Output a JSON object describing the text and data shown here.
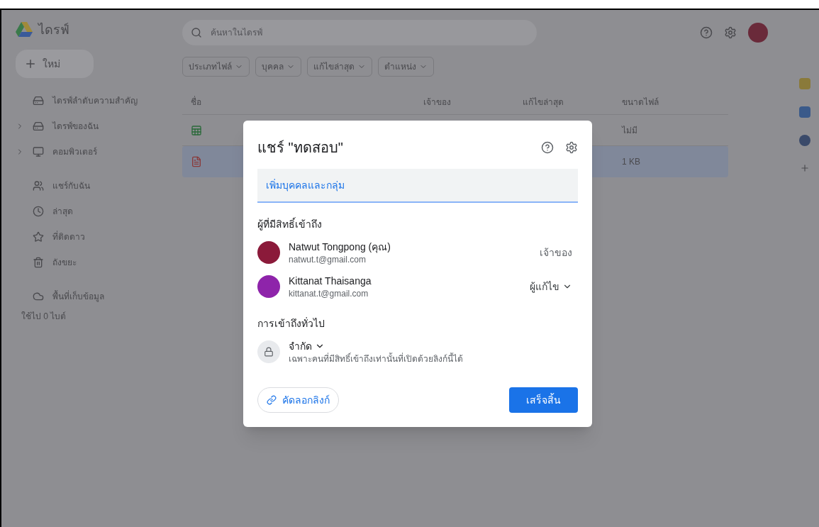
{
  "app": {
    "name": "ไดรฟ์"
  },
  "search": {
    "placeholder": "ค้นหาในไดรฟ์"
  },
  "new_button": "ใหม่",
  "sidebar": {
    "items": [
      {
        "label": "ไดรฟ์ลำดับความสำคัญ",
        "expandable": false
      },
      {
        "label": "ไดรฟ์ของฉัน",
        "expandable": true
      },
      {
        "label": "คอมพิวเตอร์",
        "expandable": true
      },
      {
        "label": "แชร์กับฉัน",
        "expandable": false
      },
      {
        "label": "ล่าสุด",
        "expandable": false
      },
      {
        "label": "ที่ติดดาว",
        "expandable": false
      },
      {
        "label": "ถังขยะ",
        "expandable": false
      }
    ],
    "storage": {
      "label": "พื้นที่เก็บข้อมูล",
      "usage": "ใช้ไป 0 ไบต์"
    }
  },
  "filters": [
    "ประเภทไฟล์",
    "บุคคล",
    "แก้ไขล่าสุด",
    "ตำแหน่ง"
  ],
  "table": {
    "columns": [
      "ชื่อ",
      "เจ้าของ",
      "แก้ไขล่าสุด",
      "ขนาดไฟล์"
    ],
    "rows": [
      {
        "kind": "sheet",
        "size": "ไม่มี",
        "selected": false
      },
      {
        "kind": "pdf",
        "size": "1 KB",
        "selected": true
      }
    ]
  },
  "dialog": {
    "title": "แชร์ \"ทดสอบ\"",
    "input": {
      "placeholder": "เพิ่มบุคคลและกลุ่ม"
    },
    "people_heading": "ผู้ที่มีสิทธิ์เข้าถึง",
    "people": [
      {
        "name": "Natwut Tongpong (คุณ)",
        "email": "natwut.t@gmail.com",
        "role": "เจ้าของ",
        "has_menu": false,
        "color": "#8b1a3a"
      },
      {
        "name": "Kittanat Thaisanga",
        "email": "kittanat.t@gmail.com",
        "role": "ผู้แก้ไข",
        "has_menu": true,
        "color": "#8e24aa"
      }
    ],
    "access_heading": "การเข้าถึงทั่วไป",
    "access": {
      "level": "จำกัด",
      "description": "เฉพาะคนที่มีสิทธิ์เข้าถึงเท่านั้นที่เปิดด้วยลิงก์นี้ได้"
    },
    "copy_link": "คัดลอกลิงก์",
    "done": "เสร็จสิ้น"
  }
}
